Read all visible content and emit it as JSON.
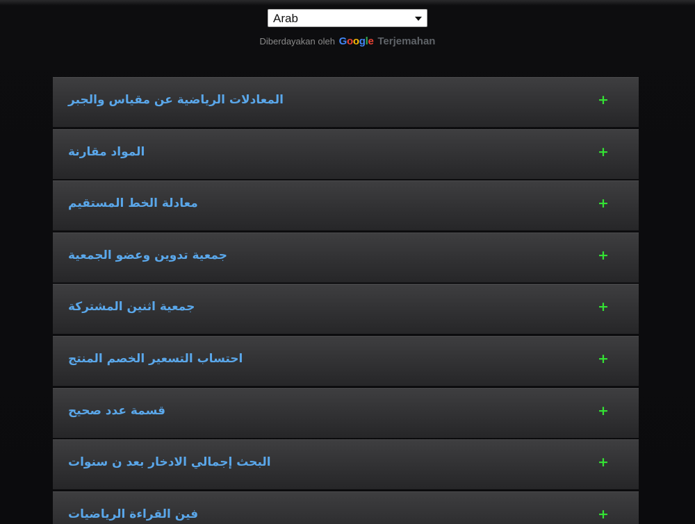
{
  "translate": {
    "selected_language": "Arab",
    "powered_by": "Diberdayakan oleh",
    "google_letters": [
      "G",
      "o",
      "o",
      "g",
      "l",
      "e"
    ],
    "google_colors": [
      "#4285F4",
      "#EA4335",
      "#FBBC05",
      "#4285F4",
      "#34A853",
      "#EA4335"
    ],
    "translate_label": "Terjemahan"
  },
  "accordion": {
    "expand_symbol": "+",
    "expand_color": "#33e333",
    "label_color": "#5aa7ea",
    "items": [
      {
        "label": "المعادلات الرياضية عن مقياس والجبر"
      },
      {
        "label": "المواد مقارنة"
      },
      {
        "label": "معادلة الخط المستقيم"
      },
      {
        "label": "جمعية تدوين وعضو الجمعية"
      },
      {
        "label": "جمعية اثنين المشتركة"
      },
      {
        "label": "احتساب التسعير الخصم المنتج"
      },
      {
        "label": "قسمة عدد صحيح"
      },
      {
        "label": "البحث إجمالي الادخار بعد ن سنوات"
      },
      {
        "label": "فين القراءة الرياضيات"
      }
    ]
  }
}
